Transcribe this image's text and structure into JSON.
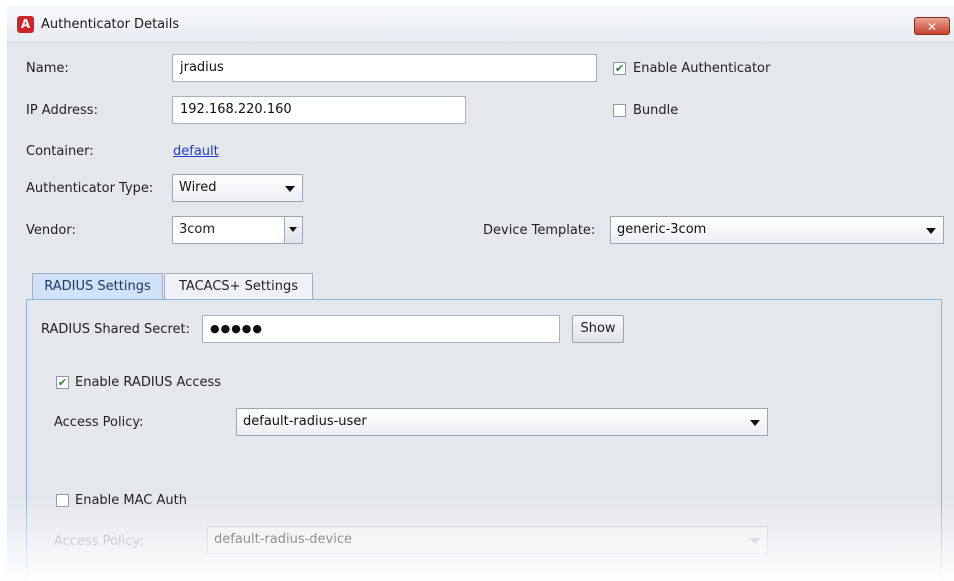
{
  "window": {
    "title": "Authenticator Details",
    "icon_letter": "A",
    "close_glyph": "✕"
  },
  "form": {
    "name_label": "Name:",
    "name_value": "jradius",
    "ip_label": "IP Address:",
    "ip_value": "192.168.220.160",
    "container_label": "Container:",
    "container_link": "default",
    "auth_type_label": "Authenticator Type:",
    "auth_type_value": "Wired",
    "vendor_label": "Vendor:",
    "vendor_value": "3com",
    "enable_auth_label": "Enable Authenticator",
    "enable_auth_checked": true,
    "bundle_label": "Bundle",
    "bundle_checked": false,
    "device_template_label": "Device Template:",
    "device_template_value": "generic-3com"
  },
  "tabs": [
    {
      "label": "RADIUS Settings",
      "active": true
    },
    {
      "label": "TACACS+ Settings",
      "active": false
    }
  ],
  "radius": {
    "secret_label": "RADIUS Shared Secret:",
    "secret_value": "●●●●●",
    "show_button": "Show",
    "enable_radius_label": "Enable RADIUS Access",
    "enable_radius_checked": true,
    "access_policy_label": "Access Policy:",
    "access_policy_value": "default-radius-user",
    "enable_mac_label": "Enable MAC Auth",
    "enable_mac_checked": false,
    "mac_access_policy_label": "Access Policy:",
    "mac_access_policy_value": "default-radius-device"
  },
  "colors": {
    "accent_tab": "#cfe2f7",
    "link": "#1a3fcf",
    "close": "#c8422c"
  }
}
